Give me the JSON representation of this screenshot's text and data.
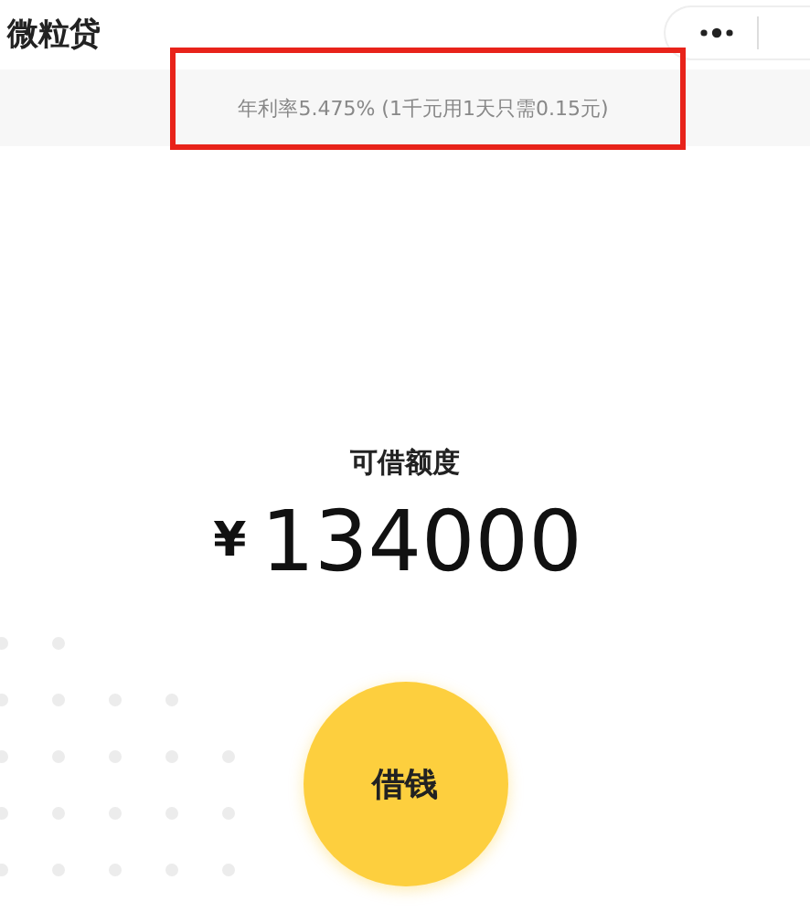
{
  "header": {
    "title": "微粒贷"
  },
  "rate_banner": {
    "text": "年利率5.475% (1千元用1天只需0.15元)"
  },
  "credit": {
    "label": "可借额度",
    "currency": "¥",
    "amount": "134000"
  },
  "borrow_button": {
    "label": "借钱"
  }
}
